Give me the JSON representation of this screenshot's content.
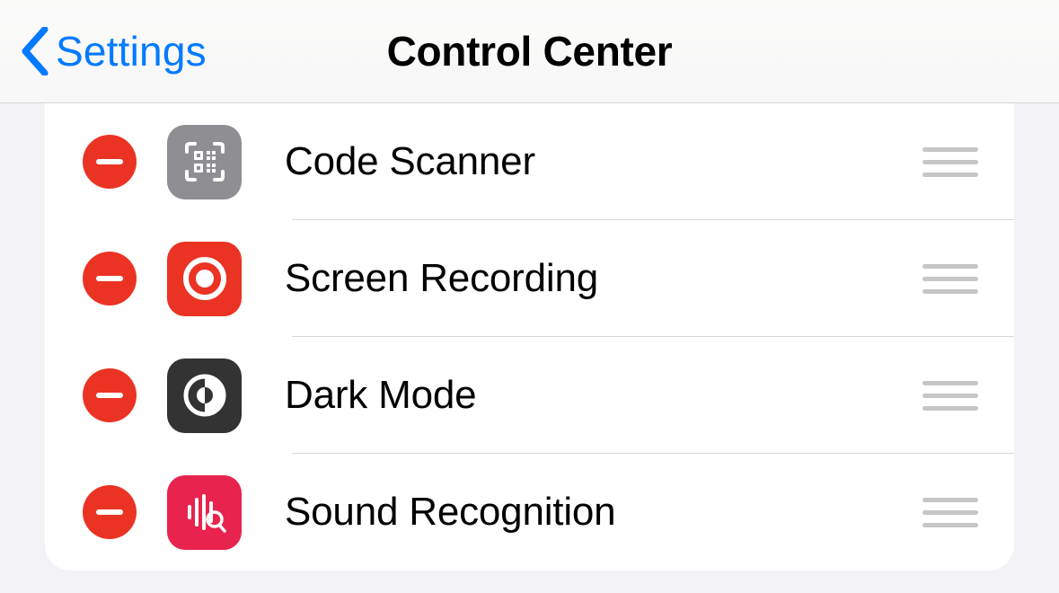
{
  "nav": {
    "back_label": "Settings",
    "title": "Control Center"
  },
  "items": [
    {
      "label": "Code Scanner",
      "icon": "qr-scanner-icon",
      "icon_bg": "ic-gray"
    },
    {
      "label": "Screen Recording",
      "icon": "screen-record-icon",
      "icon_bg": "ic-red"
    },
    {
      "label": "Dark Mode",
      "icon": "dark-mode-icon",
      "icon_bg": "ic-dark"
    },
    {
      "label": "Sound Recognition",
      "icon": "sound-recognition-icon",
      "icon_bg": "ic-pink"
    }
  ]
}
